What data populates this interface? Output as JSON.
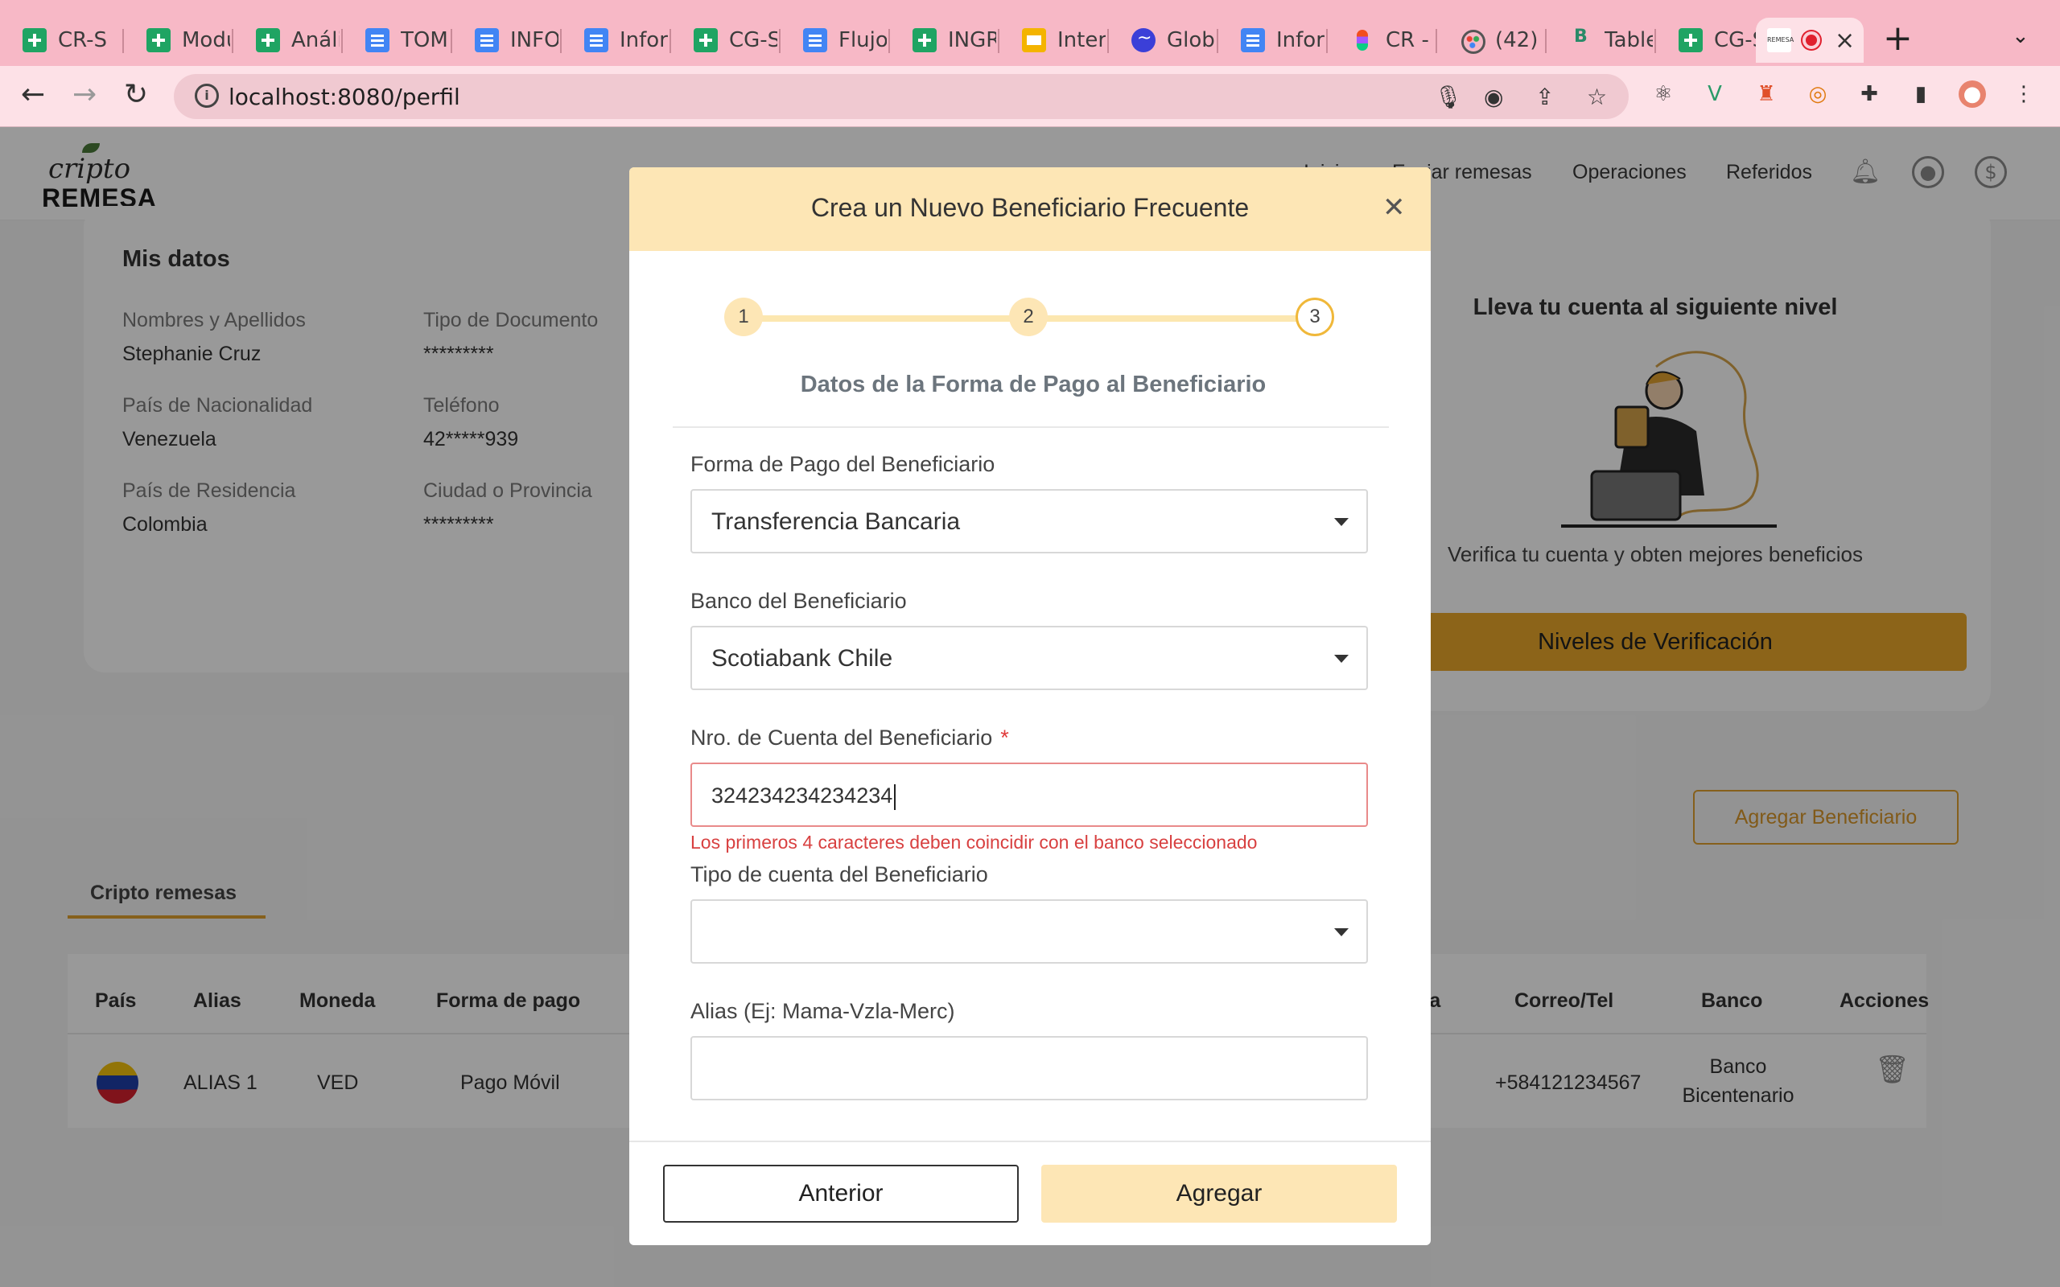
{
  "browser": {
    "tabs": [
      {
        "title": "CR-S",
        "icon": "sheets-icon"
      },
      {
        "title": "Modu",
        "icon": "sheets-icon"
      },
      {
        "title": "Análi",
        "icon": "sheets-icon"
      },
      {
        "title": "TOM",
        "icon": "docs-icon"
      },
      {
        "title": "INFO",
        "icon": "docs-icon"
      },
      {
        "title": "Inforr",
        "icon": "docs-icon"
      },
      {
        "title": "CG-S",
        "icon": "sheets-icon"
      },
      {
        "title": "Flujo",
        "icon": "docs-icon"
      },
      {
        "title": "INGR",
        "icon": "sheets-icon"
      },
      {
        "title": "Interc",
        "icon": "slides-icon"
      },
      {
        "title": "Glob",
        "icon": "globe-icon"
      },
      {
        "title": "Infor",
        "icon": "docs-icon"
      },
      {
        "title": "CR -",
        "icon": "figma-icon"
      },
      {
        "title": "(42)",
        "icon": "palette-icon"
      },
      {
        "title": "Table",
        "icon": "bootstrap-shield-icon"
      },
      {
        "title": "CG-S",
        "icon": "sheets-icon"
      }
    ],
    "active_tab": {
      "icon": "criptoremesa-favicon",
      "recording": true
    },
    "url": "localhost:8080/perfil",
    "accent": "#f7b8c6"
  },
  "app": {
    "logo_top": "cripto",
    "logo_bottom": "REMESA",
    "nav": [
      "Inicio",
      "Enviar remesas",
      "Operaciones",
      "Referidos"
    ]
  },
  "profile": {
    "section_title": "Mis datos",
    "fields": [
      {
        "label": "Nombres y Apellidos",
        "value": "Stephanie Cruz"
      },
      {
        "label": "Tipo de Documento",
        "value": "*********"
      },
      {
        "label": "País de Nacionalidad",
        "value": "Venezuela"
      },
      {
        "label": "Teléfono",
        "value": "42*****939"
      },
      {
        "label": "País de Residencia",
        "value": "Colombia"
      },
      {
        "label": "Ciudad o Provincia",
        "value": "*********"
      }
    ]
  },
  "verification": {
    "title": "Lleva tu cuenta al siguiente nivel",
    "text": "Verifica tu cuenta y obten mejores beneficios",
    "button": "Niveles de Verificación"
  },
  "beneficiaries": {
    "add_button": "Agregar Beneficiario",
    "tab": "Cripto remesas",
    "columns": [
      "País",
      "Alias",
      "Moneda",
      "Forma de pago",
      "ta",
      "Correo/Tel",
      "Banco",
      "Acciones"
    ],
    "rows": [
      {
        "flag": "venezuela-flag",
        "alias": "ALIAS 1",
        "currency": "VED",
        "payment": "Pago Móvil",
        "contact": "+584121234567",
        "bank_line1": "Banco",
        "bank_line2": "Bicentenario"
      }
    ]
  },
  "modal": {
    "title": "Crea un Nuevo Beneficiario Frecuente",
    "steps": [
      "1",
      "2",
      "3"
    ],
    "current_step": 3,
    "step_title": "Datos de la Forma de Pago al Beneficiario",
    "fields": {
      "payment_method": {
        "label": "Forma de Pago del Beneficiario",
        "value": "Transferencia Bancaria"
      },
      "bank": {
        "label": "Banco del Beneficiario",
        "value": "Scotiabank Chile"
      },
      "account_number": {
        "label": "Nro. de Cuenta del Beneficiario",
        "required": "*",
        "value": "324234234234234",
        "error": "Los primeros 4 caracteres deben coincidir con el banco seleccionado"
      },
      "account_type": {
        "label": "Tipo de cuenta del Beneficiario",
        "value": ""
      },
      "alias": {
        "label": "Alias (Ej: Mama-Vzla-Merc)",
        "value": ""
      }
    },
    "buttons": {
      "previous": "Anterior",
      "add": "Agregar"
    },
    "colors": {
      "header": "#fde6b5",
      "step_accent": "#f0b83a",
      "error": "#d84040"
    }
  }
}
